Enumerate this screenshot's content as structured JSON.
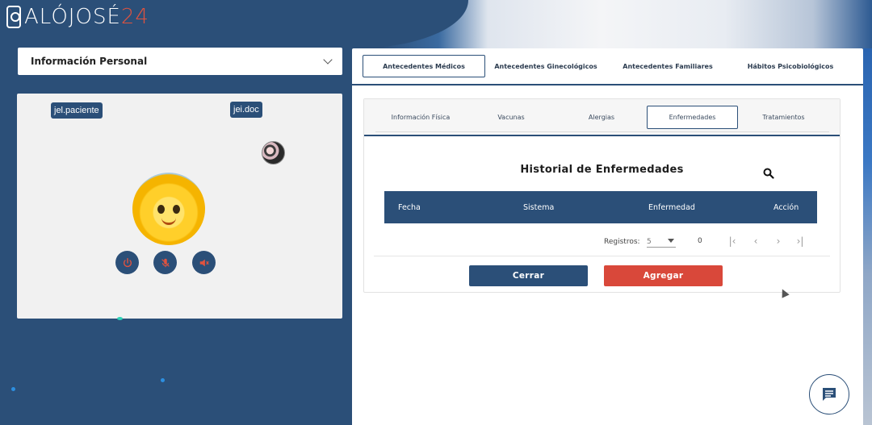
{
  "brand": {
    "logo_main": "ALÓJOSÉ",
    "logo_num": "24",
    "accent": "#e0533f",
    "primary": "#2b4f78"
  },
  "left": {
    "personal_select": {
      "label": "Información Personal",
      "icon": "chevron-down-icon"
    },
    "video": {
      "patient_tag": "jel.paciente",
      "doctor_tag": "jei.doc",
      "controls": [
        "power-icon",
        "mic-off-icon",
        "speaker-off-icon"
      ]
    }
  },
  "main_tabs": [
    {
      "label": "Antecedentes Médicos",
      "active": true
    },
    {
      "label": "Antecedentes Ginecológicos",
      "active": false
    },
    {
      "label": "Antecedentes Familiares",
      "active": false
    },
    {
      "label": "Hábitos Psicobiológicos",
      "active": false
    }
  ],
  "sub_tabs": [
    {
      "label": "Información Física",
      "active": false
    },
    {
      "label": "Vacunas",
      "active": false
    },
    {
      "label": "Alergias",
      "active": false
    },
    {
      "label": "Enfermedades",
      "active": true
    },
    {
      "label": "Tratamientos",
      "active": false
    }
  ],
  "history": {
    "title": "Historial de Enfermedades",
    "columns": [
      "Fecha",
      "Sistema",
      "Enfermedad",
      "Acción"
    ],
    "rows": []
  },
  "pager": {
    "label": "Registros:",
    "page_size": "5",
    "count": "0"
  },
  "actions": {
    "close_label": "Cerrar",
    "add_label": "Agregar",
    "danger": "#d9483a"
  }
}
